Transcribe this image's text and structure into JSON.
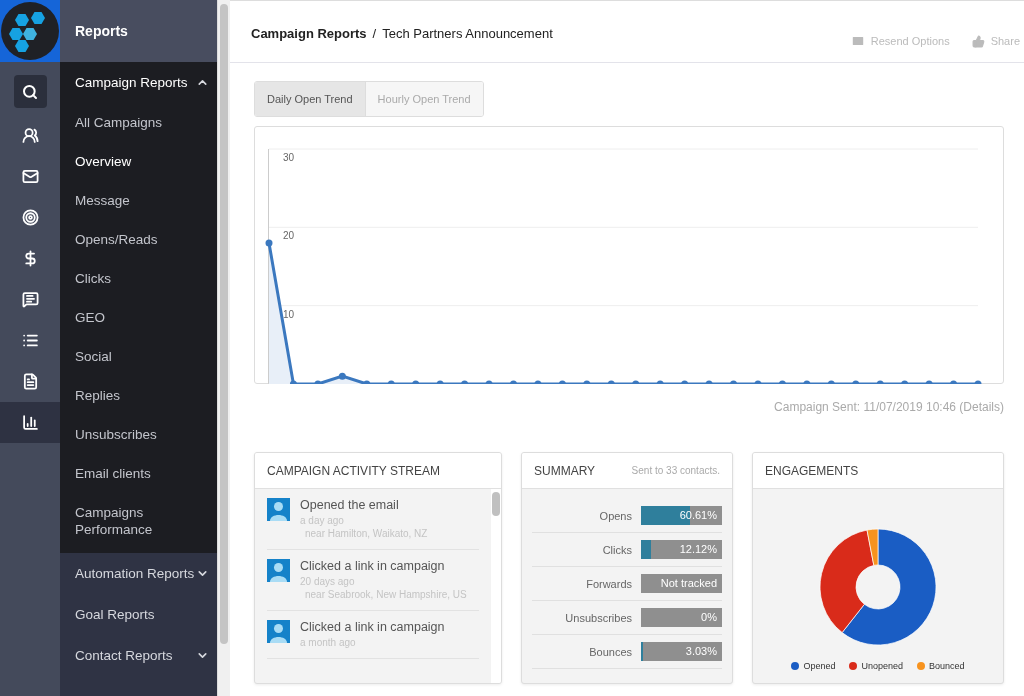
{
  "rail": [
    {
      "selected": false
    },
    {
      "selected": false
    },
    {
      "selected": false
    },
    {
      "selected": false
    },
    {
      "selected": false
    },
    {
      "selected": false
    },
    {
      "selected": false
    },
    {
      "selected": true
    }
  ],
  "menu": {
    "title": "Reports",
    "groups": [
      {
        "label": "Campaign Reports",
        "expanded": true,
        "children": [
          {
            "label": "All Campaigns",
            "selected": false
          },
          {
            "label": "Overview",
            "selected": true
          },
          {
            "label": "Message",
            "selected": false
          },
          {
            "label": "Opens/Reads",
            "selected": false
          },
          {
            "label": "Clicks",
            "selected": false
          },
          {
            "label": "GEO",
            "selected": false
          },
          {
            "label": "Social",
            "selected": false
          },
          {
            "label": "Replies",
            "selected": false
          },
          {
            "label": "Unsubscribes",
            "selected": false
          },
          {
            "label": "Email clients",
            "selected": false
          },
          {
            "label": "Campaigns Performance",
            "selected": false
          }
        ]
      },
      {
        "label": "Automation Reports",
        "expanded": false
      },
      {
        "label": "Goal Reports"
      },
      {
        "label": "Contact Reports",
        "expanded": false
      }
    ]
  },
  "breadcrumb": {
    "parent": "Campaign Reports",
    "separator": "/",
    "current": "Tech Partners Announcement"
  },
  "actions": [
    {
      "kind": "mail",
      "label": "Resend Options"
    },
    {
      "kind": "like",
      "label": "Share"
    }
  ],
  "tabs": [
    {
      "label": "Daily Open Trend",
      "selected": true
    },
    {
      "label": "Hourly Open Trend",
      "selected": false
    }
  ],
  "trend": {
    "chart_data": {
      "type": "line",
      "ylim": [
        0,
        30
      ],
      "yticks": [
        10,
        20,
        30
      ],
      "series": [
        {
          "color": "#3b78bf",
          "marker": "circle",
          "values": [
            18,
            0,
            0,
            1,
            0,
            0,
            0,
            0,
            0,
            0,
            0,
            0,
            0,
            0,
            0,
            0,
            0,
            0,
            0,
            0,
            0,
            0,
            0,
            0,
            0,
            0,
            0,
            0,
            0,
            0
          ]
        }
      ]
    }
  },
  "sent_note": "Campaign Sent: 11/07/2019 10:46 (Details)",
  "activity": {
    "title": "CAMPAIGN ACTIVITY STREAM",
    "items": [
      {
        "action": "Opened the email",
        "time": "a day ago",
        "location": "near Hamilton, Waikato, NZ"
      },
      {
        "action": "Clicked a link in campaign",
        "time": "20 days ago",
        "location": "near Seabrook, New Hampshire, US"
      },
      {
        "action": "Clicked a link in campaign",
        "time": "a month ago"
      }
    ]
  },
  "summary": {
    "title": "SUMMARY",
    "note": "Sent to 33 contacts.",
    "rows": [
      {
        "label": "Opens",
        "level": 0.6061,
        "value": "60.61%"
      },
      {
        "label": "Clicks",
        "level": 0.1212,
        "value": "12.12%"
      },
      {
        "label": "Forwards",
        "value": "Not tracked"
      },
      {
        "label": "Unsubscribes",
        "value": "0%"
      },
      {
        "label": "Bounces",
        "level": 0.0303,
        "value": "3.03%"
      }
    ]
  },
  "engagements": {
    "title": "ENGAGEMENTS",
    "chart_data": {
      "type": "donut",
      "categories": [
        "Opened",
        "Unopened",
        "Bounced"
      ],
      "values": [
        60.61,
        36.36,
        3.03
      ],
      "colors": [
        "#1a5dc4",
        "#d92b1a",
        "#f7931e"
      ]
    }
  }
}
